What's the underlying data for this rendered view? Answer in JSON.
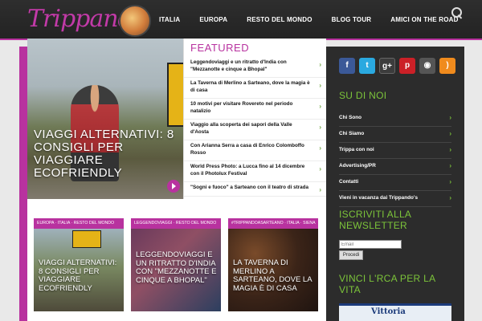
{
  "header": {
    "logo": "Trippando",
    "nav": [
      "ITALIA",
      "EUROPA",
      "RESTO DEL MONDO",
      "BLOG TOUR",
      "AMICI ON THE ROAD"
    ]
  },
  "slider": {
    "title": "VIAGGI ALTERNATIVI: 8 CONSIGLI PER VIAGGIARE ECOFRIENDLY"
  },
  "featured": {
    "title": "FEATURED",
    "items": [
      "Leggendoviaggi e un ritratto d'India con \"Mezzanotte e cinque a Bhopal\"",
      "La Taverna di Merlino a Sarteano, dove la magia è di casa",
      "10 motivi per visitare Rovereto nel periodo natalizio",
      "Viaggio alla scoperta dei sapori della Valle d'Aosta",
      "Con Arianna Serra a casa di Enrico Colomboffo Rosso",
      "World Press Photo: a Lucca fino al 14 dicembre con il Photolux Festival",
      "\"Sogni e fuoco\" a Sarteano con il teatro di strada"
    ]
  },
  "cards": [
    {
      "cat": "EUROPA · ITALIA · RESTO DEL MONDO",
      "title": "VIAGGI ALTERNATIVI: 8 CONSIGLI PER VIAGGIARE ECOFRIENDLY"
    },
    {
      "cat": "LEGGENDOVIAGGI · RESTO DEL MONDO",
      "title": "LEGGENDOVIAGGI E UN RITRATTO D'INDIA CON \"MEZZANOTTE E CINQUE A BHOPAL\""
    },
    {
      "cat": "#TRIPPANDOASARTEANO · ITALIA · SIENA",
      "title": "LA TAVERNA DI MERLINO A SARTEANO, DOVE LA MAGIA È DI CASA"
    }
  ],
  "sidebar": {
    "su_di_noi": "SU DI NOI",
    "links": [
      "Chi Sono",
      "Chi Siamo",
      "Trippa con noi",
      "Advertising/PR",
      "Contatti",
      "Vieni in vacanza dai Trippando's"
    ],
    "newsletter": "ISCRIVITI ALLA NEWSLETTER",
    "email_placeholder": "Email",
    "send": "Procedi",
    "rca": "VINCI L'RCA PER LA VITA",
    "ad": "Vittoria"
  },
  "colors": {
    "accent": "#b8329f",
    "green": "#7cc43a",
    "dark": "#2c2c2c"
  }
}
